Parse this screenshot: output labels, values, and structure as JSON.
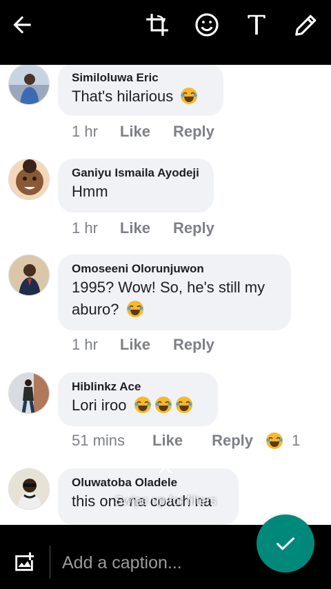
{
  "toolbar": {
    "icons": [
      "back-arrow-icon",
      "crop-rotate-icon",
      "emoji-icon",
      "text-icon",
      "pencil-icon"
    ]
  },
  "comments": [
    {
      "author": "Similoluwa Eric",
      "text": "That's hilarious",
      "emoji": [
        "joy"
      ],
      "time": "1 hr",
      "like": "Like",
      "reply": "Reply"
    },
    {
      "author": "Ganiyu Ismaila Ayodeji",
      "text": "Hmm",
      "emoji": [],
      "time": "1 hr",
      "like": "Like",
      "reply": "Reply"
    },
    {
      "author": "Omoseeni Olorunjuwon",
      "text1": "1995? Wow! So, he's still my",
      "text2": "aburo?",
      "emoji": [
        "joy"
      ],
      "time": "1 hr",
      "like": "Like",
      "reply": "Reply"
    },
    {
      "author": "Hiblinkz Ace",
      "text": "Lori iroo",
      "emoji": [
        "joy",
        "joy",
        "joy"
      ],
      "time": "51 mins",
      "like": "Like",
      "reply": "Reply",
      "reaction_count": "1"
    },
    {
      "author": "Oluwatoba Oladele",
      "text": "this one na coach na"
    }
  ],
  "overlay": {
    "swipe_hint": "Swipe up for filters"
  },
  "bottom": {
    "caption_placeholder": "Add a caption..."
  },
  "colors": {
    "send_button": "#00897b",
    "bubble": "#f0f2f5",
    "meta_text": "#7d8086"
  }
}
